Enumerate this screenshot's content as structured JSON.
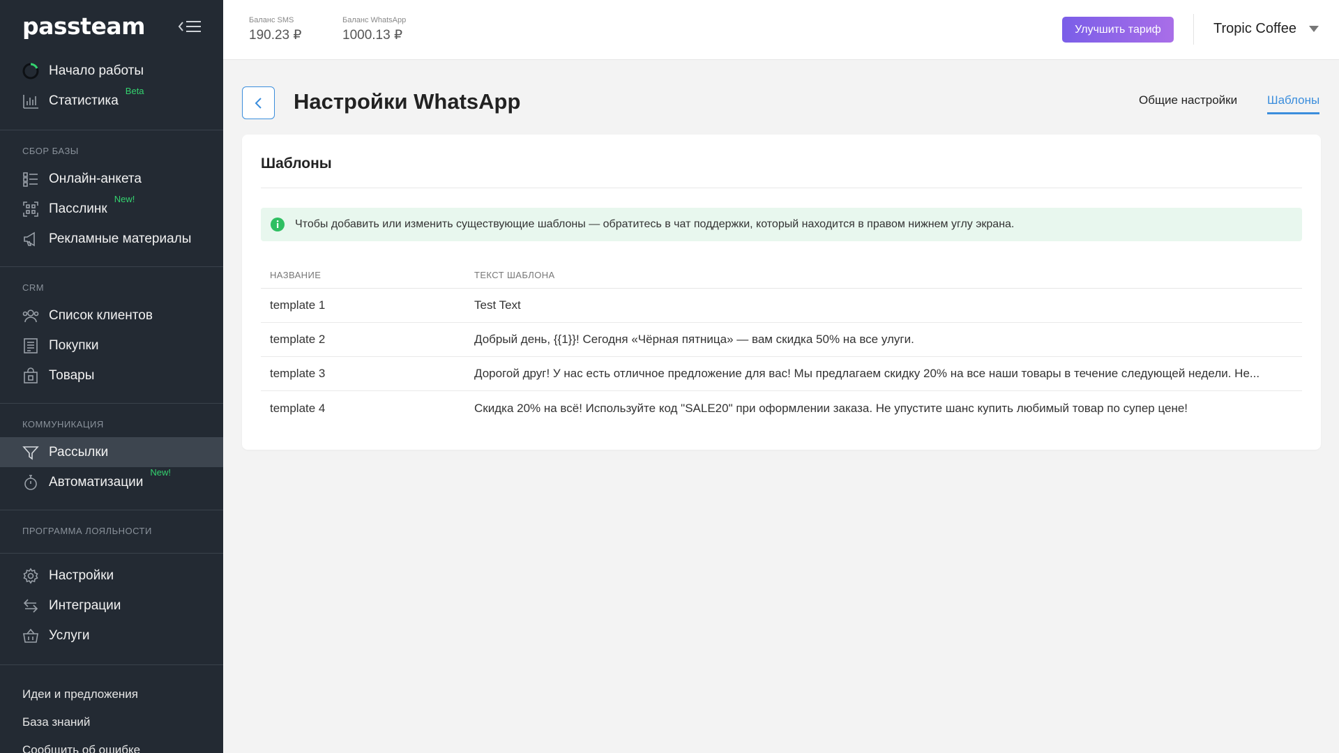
{
  "app": {
    "logo_text": "passteam"
  },
  "sidebar": {
    "top_items": [
      {
        "label": "Начало работы",
        "icon": "progress-ring-icon"
      },
      {
        "label": "Статистика",
        "icon": "bar-chart-icon",
        "tag": "Beta"
      }
    ],
    "sections": [
      {
        "title": "Сбор базы",
        "items": [
          {
            "label": "Онлайн-анкета",
            "icon": "form-icon"
          },
          {
            "label": "Пасслинк",
            "icon": "qr-code-icon",
            "tag": "New!"
          },
          {
            "label": "Рекламные материалы",
            "icon": "megaphone-icon"
          }
        ]
      },
      {
        "title": "CRM",
        "items": [
          {
            "label": "Список клиентов",
            "icon": "users-icon"
          },
          {
            "label": "Покупки",
            "icon": "receipt-icon"
          },
          {
            "label": "Товары",
            "icon": "shopping-bag-icon"
          }
        ]
      },
      {
        "title": "Коммуникация",
        "items": [
          {
            "label": "Рассылки",
            "icon": "send-icon",
            "active": true
          },
          {
            "label": "Автоматизации",
            "icon": "stopwatch-icon",
            "tag": "New!"
          }
        ]
      },
      {
        "title": "Программа лояльности",
        "items": []
      }
    ],
    "settings_items": [
      {
        "label": "Настройки",
        "icon": "gear-icon"
      },
      {
        "label": "Интеграции",
        "icon": "arrows-exchange-icon"
      },
      {
        "label": "Услуги",
        "icon": "basket-icon"
      }
    ],
    "bottom_links": [
      {
        "label": "Идеи и предложения"
      },
      {
        "label": "База знаний"
      },
      {
        "label": "Сообщить об ошибке"
      }
    ]
  },
  "topbar": {
    "balance_sms_label": "Баланс SMS",
    "balance_sms_value": "190.23 ₽",
    "balance_whatsapp_label": "Баланс WhatsApp",
    "balance_whatsapp_value": "1000.13 ₽",
    "upgrade_label": "Улучшить тариф",
    "company_name": "Tropic Coffee"
  },
  "page": {
    "title": "Настройки WhatsApp",
    "tabs": [
      {
        "label": "Общие настройки",
        "active": false
      },
      {
        "label": "Шаблоны",
        "active": true
      }
    ]
  },
  "templates": {
    "card_title": "Шаблоны",
    "info_text": "Чтобы добавить или изменить существующие шаблоны  — обратитесь в чат поддержки, который находится в правом нижнем углу экрана.",
    "columns": [
      "Название",
      "Текст шаблона"
    ],
    "rows": [
      {
        "name": "template 1",
        "text": "Test Text"
      },
      {
        "name": "template 2",
        "text": "Добрый день, {{1}}! Сегодня «Чёрная пятница» — вам скидка 50% на все улуги."
      },
      {
        "name": "template 3",
        "text": "Дорогой друг! У нас есть отличное предложение для вас! Мы предлагаем скидку 20% на все наши товары в течение следующей недели. Не..."
      },
      {
        "name": "template 4",
        "text": "Скидка 20% на всё! Используйте код \"SALE20\" при оформлении заказа. Не упустите шанс купить любимый товар по супер цене!"
      }
    ]
  },
  "colors": {
    "sidebar_bg": "#232a33",
    "accent_blue": "#3a8ddc",
    "tag_green": "#34d36f",
    "upgrade_gradient_start": "#7a5ee8",
    "upgrade_gradient_end": "#a96ee8",
    "info_bg": "#e8f7ee"
  }
}
